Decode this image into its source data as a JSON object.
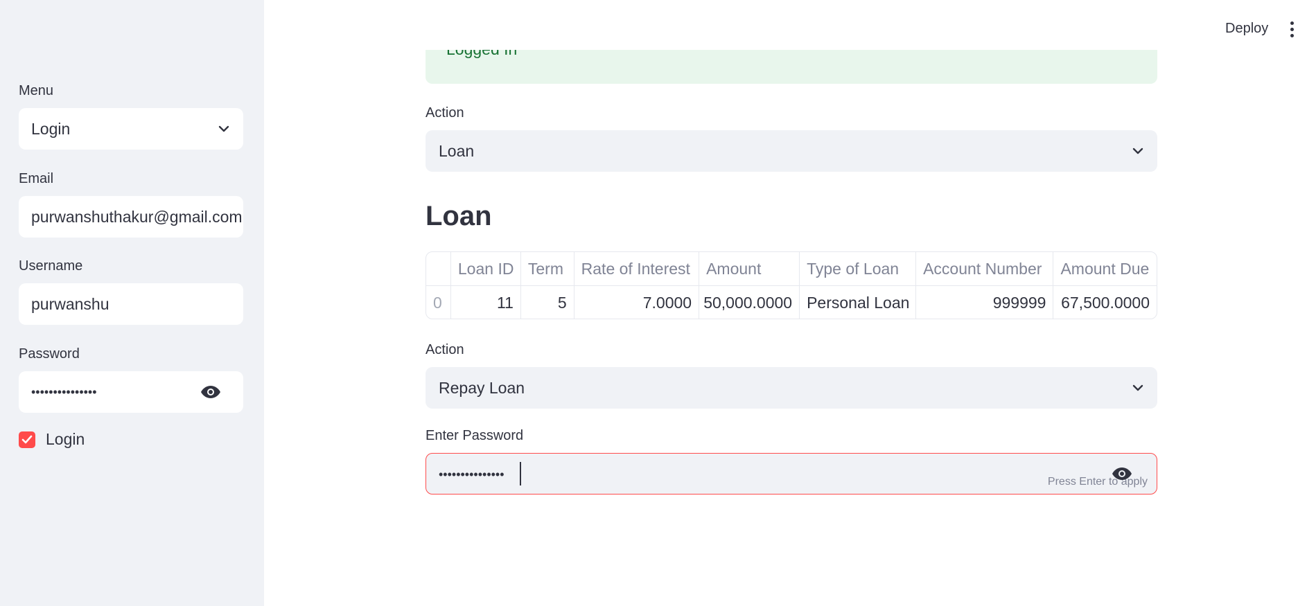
{
  "header": {
    "deploy_label": "Deploy",
    "menu_icon": "kebab-menu-icon"
  },
  "sidebar": {
    "menu_label": "Menu",
    "menu_value": "Login",
    "email_label": "Email",
    "email_value": "purwanshuthakur@gmail.com",
    "username_label": "Username",
    "username_value": "purwanshu",
    "password_label": "Password",
    "password_value": "•••••••••••••••",
    "login_checkbox_label": "Login",
    "login_checked": true
  },
  "main": {
    "success_text": "Logged In",
    "action1_label": "Action",
    "action1_value": "Loan",
    "heading": "Loan",
    "table": {
      "columns": [
        "",
        "Loan ID",
        "Term",
        "Rate of Interest",
        "Amount",
        "Type of Loan",
        "Account Number",
        "Amount Due"
      ],
      "rows": [
        [
          "0",
          "11",
          "5",
          "7.0000",
          "50,000.0000",
          "Personal Loan",
          "999999",
          "67,500.0000"
        ]
      ]
    },
    "action2_label": "Action",
    "action2_value": "Repay Loan",
    "password_label": "Enter Password",
    "password_value": "•••••••••••••••",
    "password_hint": "Press Enter to apply"
  },
  "colors": {
    "primary": "#ff4b4b",
    "sidebar_bg": "#f0f2f6",
    "success_bg": "#e8f6ec",
    "success_text": "#177233",
    "text": "#31333f"
  }
}
